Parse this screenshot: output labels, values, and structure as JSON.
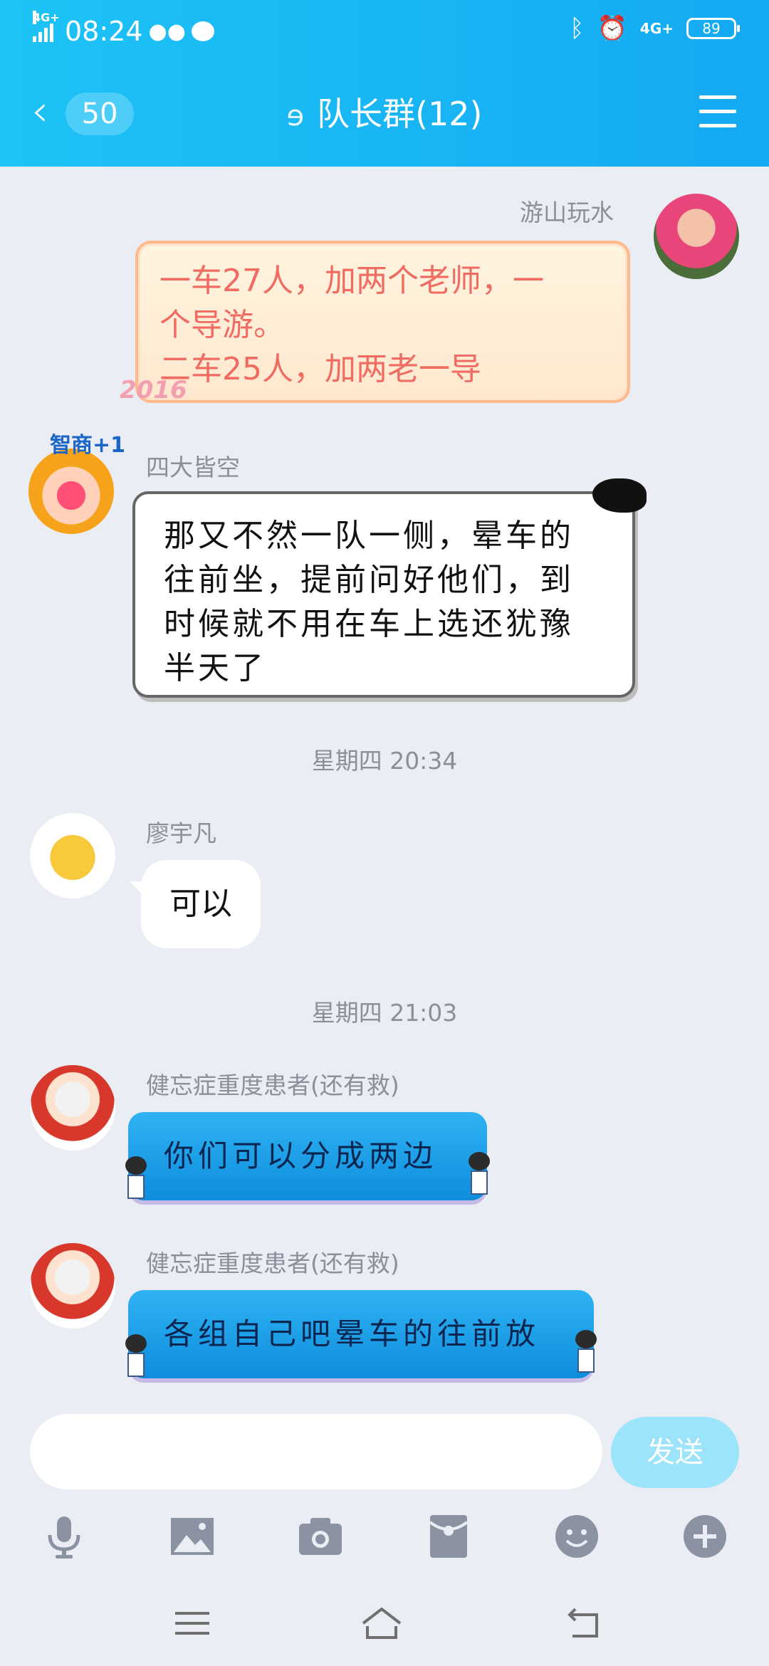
{
  "status": {
    "time": "08:24",
    "network_left": "4G+",
    "network_right": "4G+",
    "battery": "89"
  },
  "header": {
    "unread_count": "50",
    "title": "队长群(12)"
  },
  "messages": [
    {
      "sender": "游山玩水",
      "side": "right",
      "lines": [
        "一车27人，加两个老师，一",
        "个导游。",
        "二车25人，加两老一导"
      ],
      "deco": "2016"
    },
    {
      "sender": "四大皆空",
      "side": "left",
      "badge": "智商+1",
      "lines": [
        "那又不然一队一侧，晕车的",
        "往前坐，提前问好他们，到",
        "时候就不用在车上选还犹豫",
        "半天了"
      ]
    },
    {
      "timestamp": "星期四 20:34"
    },
    {
      "sender": "廖宇凡",
      "side": "left",
      "text": "可以"
    },
    {
      "timestamp": "星期四 21:03"
    },
    {
      "sender": "健忘症重度患者(还有救)",
      "side": "left",
      "text": "你们可以分成两边"
    },
    {
      "sender": "健忘症重度患者(还有救)",
      "side": "left",
      "text": "各组自己吧晕车的往前放"
    }
  ],
  "composer": {
    "send_label": "发送"
  },
  "toolbar": {
    "icons": [
      "microphone-icon",
      "image-icon",
      "camera-icon",
      "red-packet-icon",
      "emoji-icon",
      "plus-icon"
    ]
  },
  "colors": {
    "header": "#14a9f2",
    "background": "#eaedf4",
    "send_button": "#9be4fb",
    "peach_text": "#f06c62"
  }
}
